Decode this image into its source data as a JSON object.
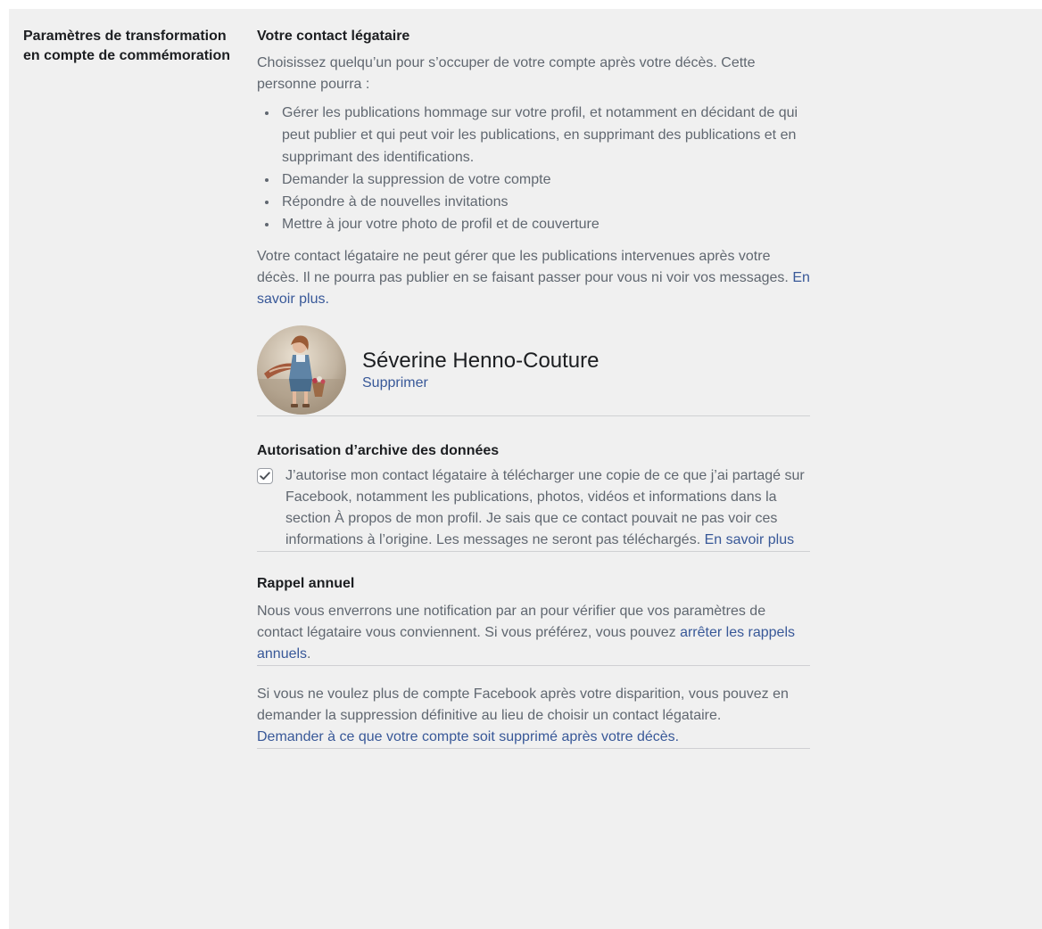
{
  "left_label": "Paramètres de transformation en compte de commémoration",
  "legacy_contact": {
    "heading": "Votre contact légataire",
    "intro": "Choisissez quelqu’un pour s’occuper de votre compte après votre décès. Cette personne pourra :",
    "permissions": [
      "Gérer les publications hommage sur votre profil, et notamment en décidant de qui peut publier et qui peut voir les publications, en supprimant des publications et en supprimant des identifications.",
      "Demander la suppression de votre compte",
      "Répondre à de nouvelles invitations",
      "Mettre à jour votre photo de profil et de couverture"
    ],
    "limits_text": "Votre contact légataire ne peut gérer que les publications intervenues après votre décès. Il ne pourra pas publier en se faisant passer pour vous ni voir vos messages.",
    "learn_more": "En savoir plus.",
    "contact_name": "Séverine Henno-Couture",
    "remove_label": "Supprimer"
  },
  "data_archive": {
    "heading": "Autorisation d’archive des données",
    "checked": true,
    "text": "J’autorise mon contact légataire à télécharger une copie de ce que j’ai partagé sur Facebook, notamment les publications, photos, vidéos et informations dans la section À propos de mon profil. Je sais que ce contact pouvait ne pas voir ces informations à l’origine. Les messages ne seront pas téléchargés.",
    "learn_more": "En savoir plus"
  },
  "annual_reminder": {
    "heading": "Rappel annuel",
    "text": "Nous vous enverrons une notification par an pour vérifier que vos paramètres de contact légataire vous conviennent. Si vous préférez, vous pouvez",
    "link": "arrêter les rappels annuels",
    "suffix": "."
  },
  "deletion": {
    "text": "Si vous ne voulez plus de compte Facebook après votre disparition, vous pouvez en demander la suppression définitive au lieu de choisir un contact légataire.",
    "link": "Demander à ce que votre compte soit supprimé après votre décès."
  },
  "colors": {
    "panel_bg": "#f0f0f0",
    "text_primary": "#1c1e21",
    "text_secondary": "#606770",
    "link": "#385898",
    "divider": "#cfd0d3"
  }
}
